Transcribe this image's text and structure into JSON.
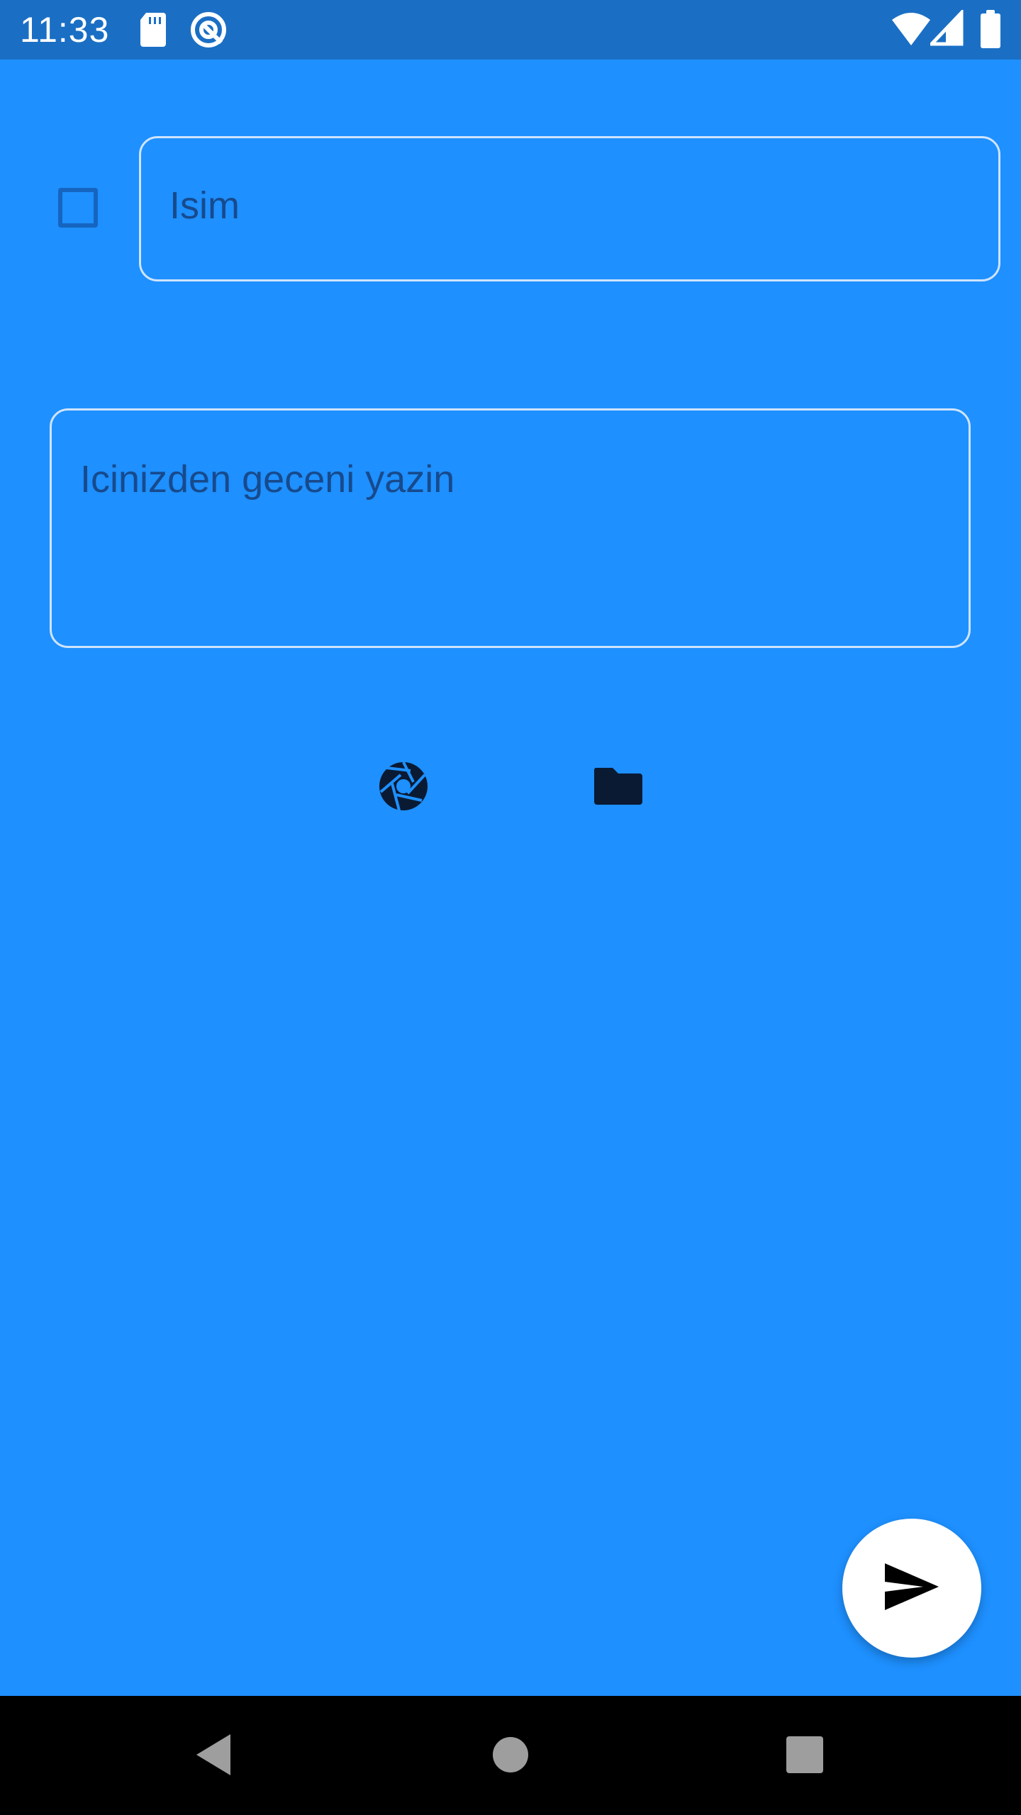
{
  "status_bar": {
    "time": "11:33",
    "left_icons": [
      "sd-card-icon",
      "notification-ring-icon"
    ],
    "right_icons": [
      "wifi-icon",
      "signal-icon",
      "battery-icon"
    ],
    "background": "#1a6fc4"
  },
  "form": {
    "name_placeholder": "Isim",
    "message_placeholder": "Icinizden geceni yazin",
    "checkbox_checked": false
  },
  "actions": {
    "camera_icon": "camera-aperture-icon",
    "folder_icon": "folder-icon",
    "send_icon": "send-icon"
  },
  "nav_bar": {
    "buttons": [
      "back-icon",
      "home-icon",
      "recents-icon"
    ]
  },
  "colors": {
    "background": "#1e90ff",
    "text": "#174a8c",
    "field_border": "#cfe4fb",
    "fab": "#ffffff"
  }
}
